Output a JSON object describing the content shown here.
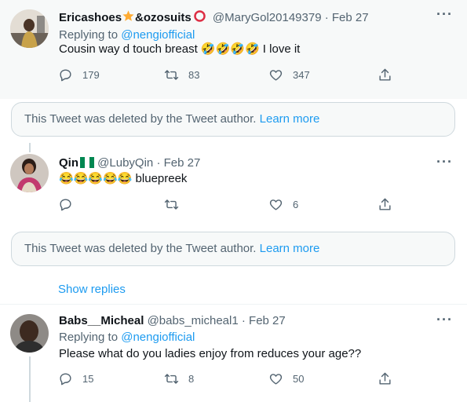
{
  "tweet1": {
    "name": "Ericashoes",
    "name_mid": "&ozosuits",
    "handle": "@MaryGol20149379",
    "sep": "·",
    "date": "Feb 27",
    "replying_prefix": "Replying to",
    "replying_handle": "@nengiofficial",
    "text": "Cousin way d touch breast 🤣🤣🤣🤣 I love it",
    "replies": "179",
    "retweets": "83",
    "likes": "347",
    "more_label": "···"
  },
  "deleted1": {
    "message": "This Tweet was deleted by the Tweet author.",
    "learn_more": "Learn more"
  },
  "tweet2": {
    "name": "Qin",
    "handle": "@LubyQin",
    "sep": "·",
    "date": "Feb 27",
    "text": "😂😂😂😂😂 bluepreek",
    "replies": "",
    "retweets": "",
    "likes": "6",
    "more_label": "···"
  },
  "deleted2": {
    "message": "This Tweet was deleted by the Tweet author.",
    "learn_more": "Learn more"
  },
  "show_replies": "Show replies",
  "tweet3": {
    "name": "Babs__Micheal",
    "handle": "@babs_micheal1",
    "sep": "·",
    "date": "Feb 27",
    "replying_prefix": "Replying to",
    "replying_handle": "@nengiofficial",
    "text": "Please what do you ladies enjoy from reduces your age??",
    "replies": "15",
    "retweets": "8",
    "likes": "50",
    "more_label": "···"
  },
  "colors": {
    "accent": "#1d9bf0",
    "secondary_text": "#536471",
    "border": "#cfd9de",
    "highlight_bg": "#f7f9f9"
  }
}
